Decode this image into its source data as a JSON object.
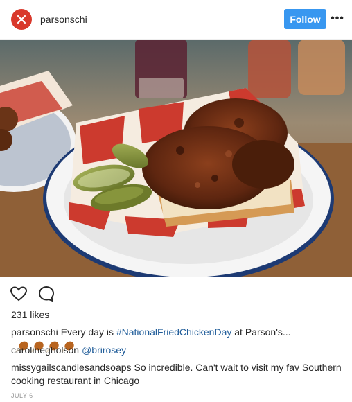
{
  "header": {
    "username": "parsonschi",
    "follow_label": "Follow",
    "more_label": "•••"
  },
  "post": {
    "likes": "231 likes"
  },
  "comments": [
    {
      "user": "parsonschi",
      "text_before": "Every day is ",
      "hashtag": "#NationalFriedChickenDay",
      "text_after": " at Parson's..."
    },
    {
      "user": "carolinegholson",
      "mention": "@brirosey"
    },
    {
      "user": "missygailscandlesandsoaps",
      "text": "So incredible. Can't wait to visit my fav Southern cooking restaurant in Chicago"
    }
  ],
  "date": "JULY 6",
  "colors": {
    "follow_button": "#3897f0",
    "avatar": "#d9382b",
    "link": "#1f5c99"
  }
}
